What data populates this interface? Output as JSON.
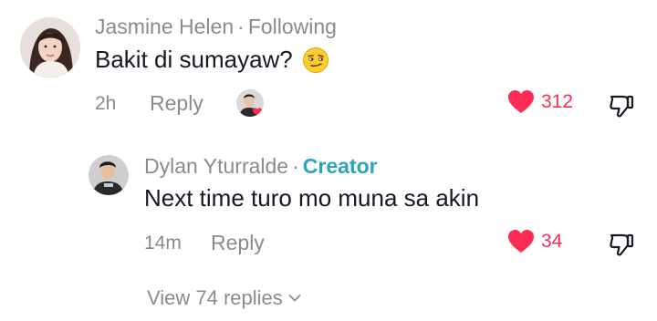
{
  "comment": {
    "author": "Jasmine Helen",
    "separator": "·",
    "relation": "Following",
    "text": "Bakit di sumayaw?",
    "emoji": "smirk-face-icon",
    "time": "2h",
    "reply_label": "Reply",
    "likes": "312"
  },
  "reply": {
    "author": "Dylan Yturralde",
    "separator": "·",
    "badge": "Creator",
    "text": "Next time turo mo muna sa akin",
    "time": "14m",
    "reply_label": "Reply",
    "likes": "34"
  },
  "view_replies_label": "View 74 replies",
  "colors": {
    "like": "#fe2c55",
    "creator": "#2aa6b9",
    "muted": "#8a8b91",
    "text": "#161823"
  }
}
